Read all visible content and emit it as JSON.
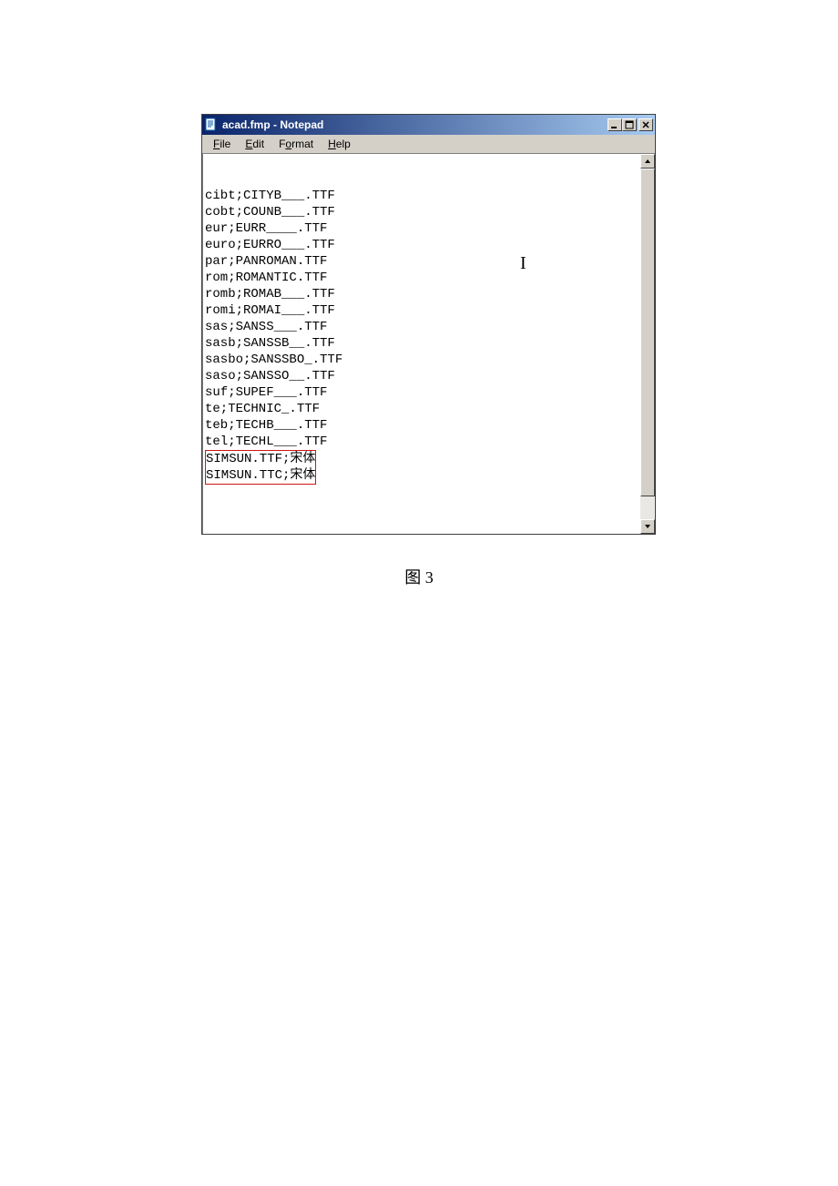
{
  "window": {
    "title": "acad.fmp - Notepad"
  },
  "menu": {
    "file": "File",
    "file_u": "F",
    "edit": "Edit",
    "edit_u": "E",
    "format": "Format",
    "format_u": "o",
    "help": "Help",
    "help_u": "H"
  },
  "lines": [
    "cibt;CITYB___.TTF",
    "cobt;COUNB___.TTF",
    "eur;EURR____.TTF",
    "euro;EURRO___.TTF",
    "par;PANROMAN.TTF",
    "rom;ROMANTIC.TTF",
    "romb;ROMAB___.TTF",
    "romi;ROMAI___.TTF",
    "sas;SANSS___.TTF",
    "sasb;SANSSB__.TTF",
    "sasbo;SANSSBO_.TTF",
    "saso;SANSSO__.TTF",
    "suf;SUPEF___.TTF",
    "te;TECHNIC_.TTF",
    "teb;TECHB___.TTF",
    "tel;TECHL___.TTF"
  ],
  "highlighted_lines": [
    "SIMSUN.TTF;宋体",
    "SIMSUN.TTC;宋体"
  ],
  "caption": "图 3"
}
